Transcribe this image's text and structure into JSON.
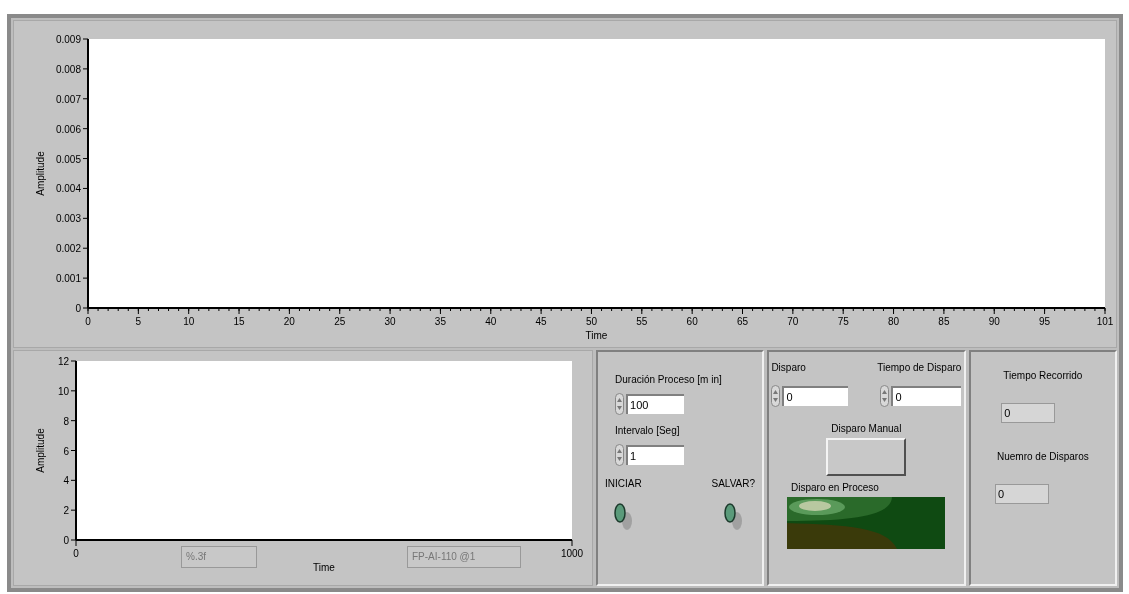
{
  "waveform_graph": {
    "chart_data": {
      "type": "line",
      "xlabel": "Time",
      "ylabel": "Amplitude",
      "xlim": [
        0,
        101
      ],
      "ylim": [
        0,
        0.009
      ],
      "xticks": [
        0,
        5,
        10,
        15,
        20,
        25,
        30,
        35,
        40,
        45,
        50,
        55,
        60,
        65,
        70,
        75,
        80,
        85,
        90,
        95,
        101
      ],
      "yticks": [
        0,
        0.001,
        0.002,
        0.003,
        0.004,
        0.005,
        0.006,
        0.007,
        0.008,
        0.009
      ]
    }
  },
  "process_graph": {
    "chart_data": {
      "type": "line",
      "xlabel": "Time",
      "ylabel": "Amplitude",
      "xlim": [
        0,
        1000
      ],
      "ylim": [
        0,
        12
      ],
      "xticks": [
        0,
        1000
      ],
      "yticks": [
        0,
        2,
        4,
        6,
        8,
        10,
        12
      ]
    },
    "indicators": [
      "%.3f",
      "FP-AI-110 @1"
    ]
  },
  "process_controls": {
    "numerics": [
      {
        "label": "Duración Proceso [m in]",
        "value": "100"
      },
      {
        "label": "Intervalo [Seg]",
        "value": "1"
      }
    ],
    "switches": [
      {
        "label": "INICIAR",
        "on": false
      },
      {
        "label": "SALVAR?",
        "on": false
      }
    ]
  },
  "trigger_panel": {
    "numerics": [
      {
        "label": "Disparo",
        "value": "0"
      },
      {
        "label": "Tiempo de Disparo",
        "value": "0"
      }
    ],
    "manual_button": {
      "label": "Disparo Manual"
    },
    "led": {
      "label": "Disparo en Proceso"
    }
  },
  "status_panel": {
    "fields": [
      {
        "label": "Tiempo Recorrido",
        "value": "0"
      },
      {
        "label": "Nuemro de Disparos",
        "value": "0"
      }
    ]
  }
}
